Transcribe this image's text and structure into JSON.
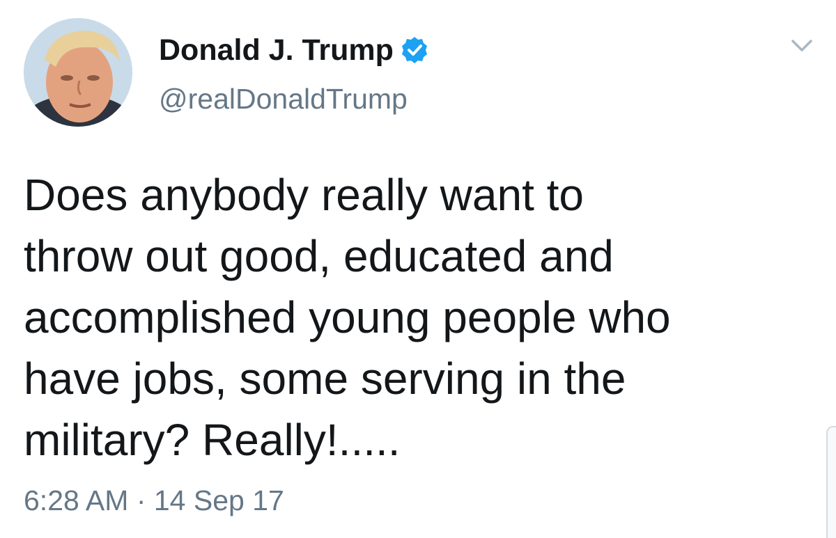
{
  "author": {
    "display_name": "Donald J. Trump",
    "handle": "@realDonaldTrump",
    "verified": true,
    "verified_icon": "verified-badge-icon",
    "avatar_icon": "profile-avatar"
  },
  "tweet": {
    "text": "Does anybody really want to\nthrow out good, educated and\naccomplished young people who\nhave jobs, some serving in the\nmilitary? Really!.....",
    "timestamp": "6:28 AM · 14 Sep 17"
  },
  "menu": {
    "icon": "chevron-down-icon"
  },
  "colors": {
    "text_primary": "#14171a",
    "text_secondary": "#657786",
    "verified_blue": "#1da1f2",
    "caret_gray": "#aab8c2",
    "background": "#ffffff"
  }
}
